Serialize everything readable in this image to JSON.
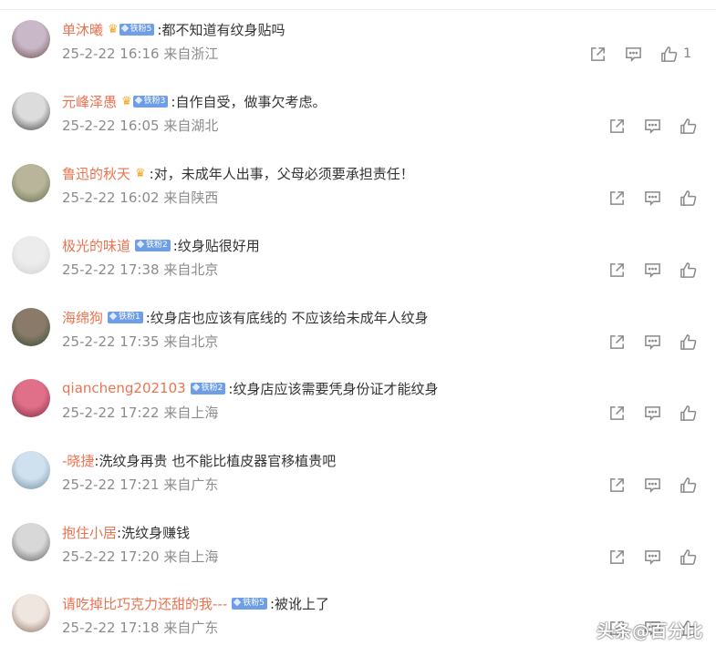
{
  "comments": [
    {
      "user": "单沐曦",
      "has_crown": true,
      "fan_badge": "铁粉5",
      "text": ":都不知道有纹身贴吗",
      "time": "25-2-22 16:16",
      "location": "来自浙江",
      "likes": "1",
      "avatar_colors": [
        "#c9b8c8",
        "#6b4a4a"
      ]
    },
    {
      "user": "元峰泽愚",
      "has_crown": true,
      "fan_badge": "铁粉3",
      "text": ":自作自受，做事欠考虑。",
      "time": "25-2-22 16:05",
      "location": "来自湖北",
      "likes": "",
      "avatar_colors": [
        "#dcdcdc",
        "#3a3a3a"
      ]
    },
    {
      "user": "鲁迅的秋天",
      "has_crown": true,
      "fan_badge": "",
      "text": ":对，未成年人出事，父母必须要承担责任！",
      "time": "25-2-22 16:02",
      "location": "来自陕西",
      "likes": "",
      "avatar_colors": [
        "#b8b59a",
        "#5e6a45"
      ]
    },
    {
      "user": "极光的味道",
      "has_crown": false,
      "fan_badge": "铁粉2",
      "text": ":纹身贴很好用",
      "time": "25-2-22 17:38",
      "location": "来自北京",
      "likes": "",
      "avatar_colors": [
        "#ececec",
        "#d0d0d0"
      ]
    },
    {
      "user": "海绵狗",
      "has_crown": false,
      "fan_badge": "铁粉1",
      "text": ":纹身店也应该有底线的 不应该给未成年人纹身",
      "time": "25-2-22 17:35",
      "location": "来自北京",
      "likes": "",
      "avatar_colors": [
        "#8a7a6a",
        "#2e4a2a"
      ]
    },
    {
      "user": "qiancheng202103",
      "has_crown": false,
      "fan_badge": "铁粉2",
      "text": ":纹身店应该需要凭身份证才能纹身",
      "time": "25-2-22 17:22",
      "location": "来自上海",
      "likes": "",
      "avatar_colors": [
        "#e0708a",
        "#7a2a3a"
      ]
    },
    {
      "user": "-晓捷",
      "has_crown": false,
      "fan_badge": "",
      "text": ":洗纹身再贵 也不能比植皮器官移植贵吧",
      "time": "25-2-22 17:21",
      "location": "来自广东",
      "likes": "",
      "avatar_colors": [
        "#cfe0ee",
        "#6a8aa0"
      ]
    },
    {
      "user": "抱住小居",
      "has_crown": false,
      "fan_badge": "",
      "text": ":洗纹身赚钱",
      "time": "25-2-22 17:20",
      "location": "来自上海",
      "likes": "",
      "avatar_colors": [
        "#d8d8d8",
        "#5a5a5a"
      ]
    },
    {
      "user": "请吃掉比巧克力还甜的我---",
      "has_crown": false,
      "fan_badge": "铁粉5",
      "text": ":被讹上了",
      "time": "25-2-22 17:18",
      "location": "来自广东",
      "likes": "",
      "avatar_colors": [
        "#efe6e0",
        "#8a6a5a"
      ]
    }
  ],
  "icons": {
    "share": "share-icon",
    "comment": "comment-icon",
    "like": "thumbs-up-icon",
    "crown": "crown-icon"
  },
  "watermark": "头条@百分比",
  "colors": {
    "username": "#eb7350",
    "meta": "#8c8c8c",
    "fan_badge": "#6e9ee6"
  }
}
